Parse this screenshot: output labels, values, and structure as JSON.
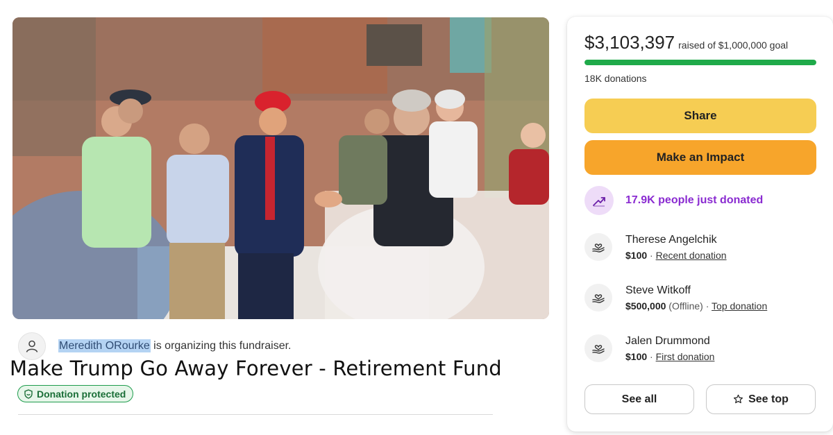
{
  "organizer": {
    "name": "Meredith ORourke",
    "suffix": " is organizing this fundraiser."
  },
  "fundraiser": {
    "title": "Make Trump Go Away Forever - Retirement Fund",
    "protected_label": "Donation protected"
  },
  "summary": {
    "raised": "$3,103,397",
    "goal_text": "raised of $1,000,000 goal",
    "progress_fraction": 1.0,
    "donations": "18K donations"
  },
  "buttons": {
    "share": "Share",
    "impact": "Make an Impact",
    "see_all": "See all",
    "see_top": "See top"
  },
  "recent": {
    "text": "17.9K people just donated"
  },
  "donors": [
    {
      "name": "Therese Angelchik",
      "amount": "$100",
      "note": "",
      "tag": "Recent donation"
    },
    {
      "name": "Steve Witkoff",
      "amount": "$500,000",
      "note": " (Offline)",
      "tag": "Top donation"
    },
    {
      "name": "Jalen Drummond",
      "amount": "$100",
      "note": "",
      "tag": "First donation"
    }
  ],
  "colors": {
    "progress": "#1faa4a",
    "share_button": "#f6cd53",
    "impact_button": "#f7a52b",
    "recent_accent": "#8a2bd1",
    "protected_green": "#1d9c4c"
  }
}
